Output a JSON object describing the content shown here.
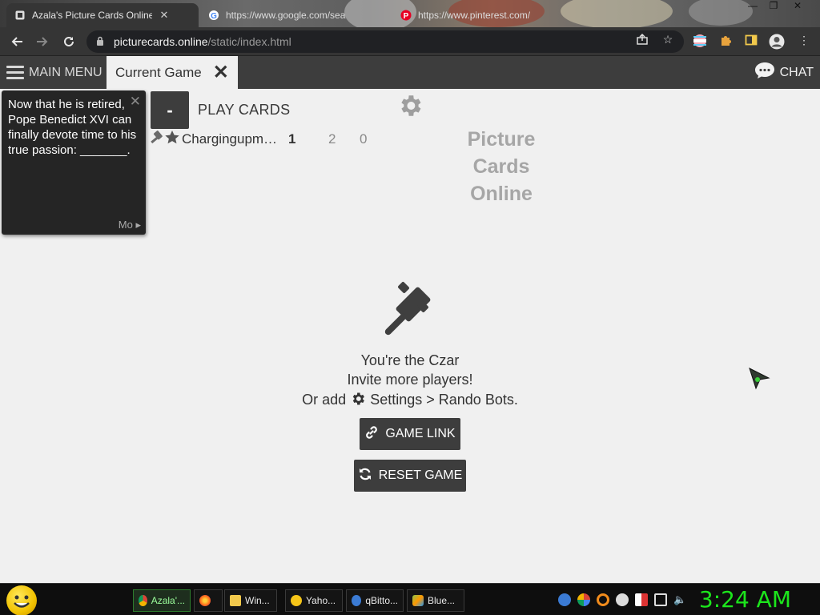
{
  "browser": {
    "tabs": [
      {
        "title": "Azala's Picture Cards Online",
        "active": true
      },
      {
        "title": "https://www.google.com/search",
        "active": false
      },
      {
        "title": "https://www.pinterest.com/pin",
        "active": false
      }
    ],
    "url_domain": "picturecards.online",
    "url_path": "/static/index.html"
  },
  "app": {
    "main_menu_label": "MAIN MENU",
    "current_tab_label": "Current Game",
    "chat_label": "CHAT"
  },
  "black_card": {
    "prompt": "Now that he is retired, Pope Benedict XVI can finally devote time to his true passion: _______.",
    "more_label": "Mo"
  },
  "game": {
    "minus_label": "-",
    "play_cards_label": "PLAY CARDS",
    "player": {
      "name": "Chargingupm…",
      "scores": [
        "1",
        "2",
        "0"
      ]
    },
    "logo_lines": [
      "Picture",
      "Cards",
      "Online"
    ],
    "status": {
      "line1": "You're the Czar",
      "line2": "Invite more players!",
      "line3_prefix": "Or add",
      "line3_suffix": "Settings > Rando Bots."
    },
    "game_link_label": "GAME LINK",
    "reset_game_label": "RESET GAME"
  },
  "taskbar": {
    "tasks": [
      "Azala'...",
      "",
      "Win...",
      "Yaho...",
      "qBitto...",
      "Blue..."
    ],
    "clock": "3:24 AM"
  },
  "colors": {
    "header_bg": "#3d3d3d",
    "page_bg": "#f0f0f0",
    "card_bg": "#252525",
    "clock": "#1ce61c"
  }
}
